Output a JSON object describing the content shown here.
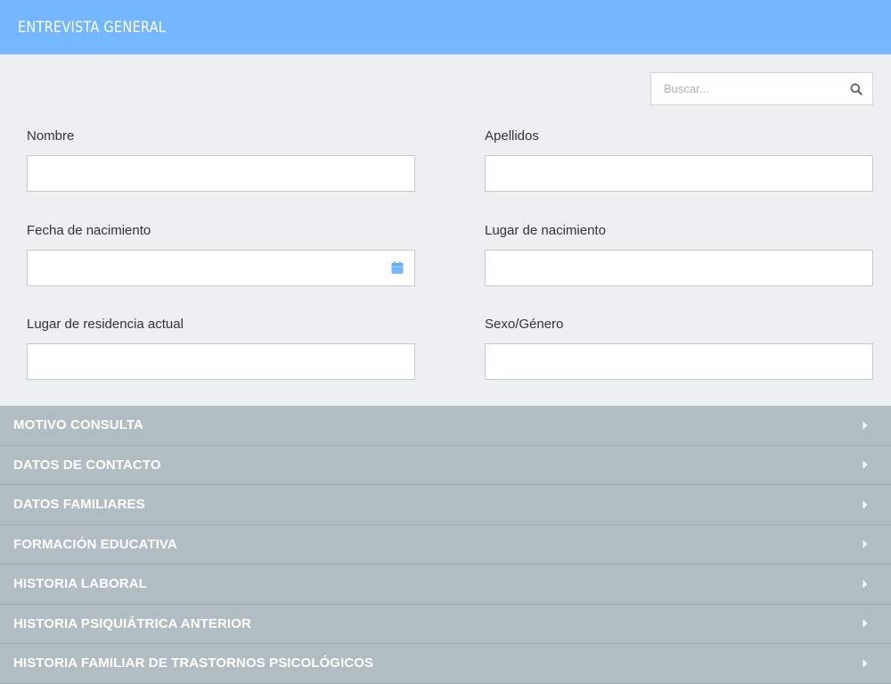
{
  "header": {
    "title": "ENTREVISTA GENERAL"
  },
  "search": {
    "placeholder": "Buscar...",
    "value": "",
    "icon": "search-icon"
  },
  "form": {
    "nombre": {
      "label": "Nombre",
      "value": ""
    },
    "apellidos": {
      "label": "Apellidos",
      "value": ""
    },
    "fecha_nacimiento": {
      "label": "Fecha de nacimiento",
      "value": "",
      "icon": "calendar-icon"
    },
    "lugar_nacimiento": {
      "label": "Lugar de nacimiento",
      "value": ""
    },
    "residencia": {
      "label": "Lugar de residencia actual",
      "value": ""
    },
    "sexo": {
      "label": "Sexo/Género",
      "value": ""
    }
  },
  "sections": [
    {
      "label": "MOTIVO CONSULTA"
    },
    {
      "label": "DATOS DE CONTACTO"
    },
    {
      "label": "DATOS FAMILIARES"
    },
    {
      "label": "FORMACIÓN EDUCATIVA"
    },
    {
      "label": "HISTORIA LABORAL"
    },
    {
      "label": "HISTORIA PSIQUIÁTRICA ANTERIOR"
    },
    {
      "label": "HISTORIA FAMILIAR DE TRASTORNOS PSICOLÓGICOS"
    }
  ],
  "colors": {
    "header_bg": "#74b6ff",
    "page_bg": "#edf0f1",
    "section_bg": "#b2bcc3",
    "calendar_icon": "#74b6ff"
  }
}
